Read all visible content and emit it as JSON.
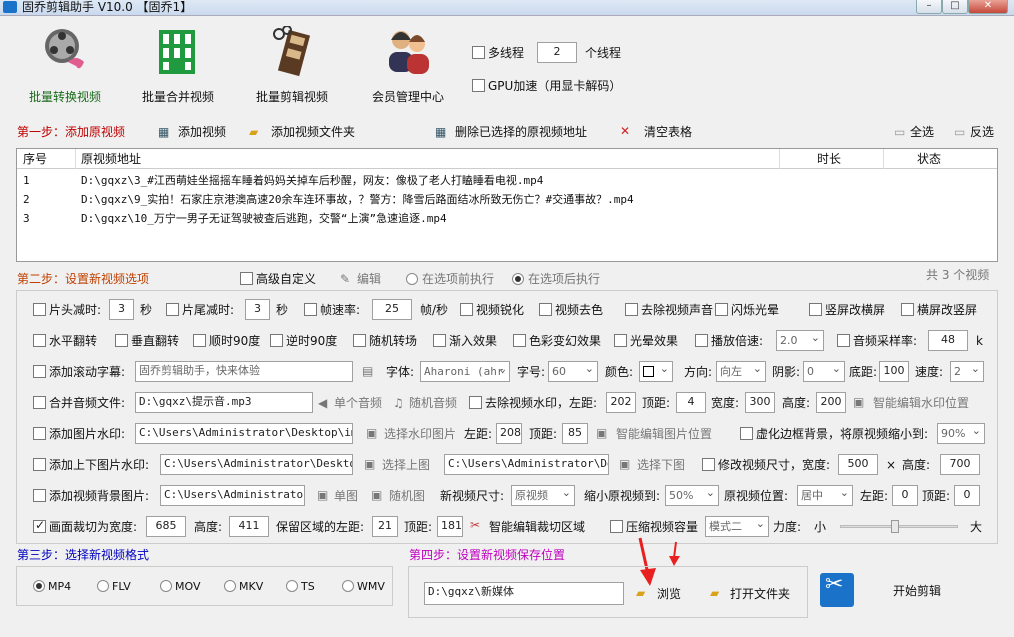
{
  "window": {
    "title": "固乔剪辑助手 V10.0 【固乔1】",
    "min": "–",
    "max": "□",
    "close": "✕"
  },
  "toolbar": {
    "batch_convert": "批量转换视频",
    "batch_merge": "批量合并视频",
    "batch_edit": "批量剪辑视频",
    "member_center": "会员管理中心",
    "multithread_label": "多线程",
    "thread_count": "2",
    "thread_unit": "个线程",
    "gpu_label": "GPU加速（用显卡解码）"
  },
  "step1": {
    "title": "第一步：添加原视频",
    "add_video": "添加视频",
    "add_folder": "添加视频文件夹",
    "delete_selected": "删除已选择的原视频地址",
    "clear_table": "清空表格",
    "select_all": "全选",
    "invert": "反选"
  },
  "table": {
    "headers": {
      "index": "序号",
      "path": "原视频地址",
      "duration": "时长",
      "status": "状态"
    },
    "rows": [
      {
        "index": "1",
        "path": "D:\\gqxz\\3_#江西萌娃坐摇摇车睡着妈妈关掉车后秒醒，网友：像极了老人打瞌睡看电视.mp4"
      },
      {
        "index": "2",
        "path": "D:\\gqxz\\9_实拍！石家庄京港澳高速20余车连环事故，？警方：降雪后路面结冰所致无伤亡？#交通事故？.mp4"
      },
      {
        "index": "3",
        "path": "D:\\gqxz\\10_万宁一男子无证驾驶被查后逃跑，交警“上演”急速追逐.mp4"
      }
    ]
  },
  "step2": {
    "title": "第二步：设置新视频选项",
    "advanced": "高级自定义",
    "edit": "编辑",
    "before": "在选项前执行",
    "after": "在选项后执行",
    "count": "共 3 个视频",
    "r1": {
      "head_cut": "片头减时:",
      "head_val": "3",
      "sec1": "秒",
      "tail_cut": "片尾减时:",
      "tail_val": "3",
      "sec2": "秒",
      "fps": "帧速率:",
      "fps_val": "25",
      "fps_unit": "帧/秒",
      "sharpen": "视频锐化",
      "decolor": "视频去色",
      "mute": "去除视频声音",
      "flash": "闪烁光晕",
      "v2h": "竖屏改横屏",
      "h2v": "横屏改竖屏"
    },
    "r2": {
      "hflip": "水平翻转",
      "vflip": "垂直翻转",
      "cw90": "顺时90度",
      "ccw90": "逆时90度",
      "random_transition": "随机转场",
      "fade_in": "渐入效果",
      "color_shift": "色彩变幻效果",
      "glow": "光晕效果",
      "speed_label": "播放倍速:",
      "speed_val": "2.0",
      "sample_label": "音频采样率:",
      "sample_val": "48",
      "sample_unit": "k"
    },
    "r3": {
      "scroll_caption": "添加滚动字幕:",
      "caption_text": "固乔剪辑助手，快来体验",
      "font_label": "字体:",
      "font_val": "Aharoni (ahr",
      "size_label": "字号:",
      "size_val": "60",
      "color_label": "颜色:",
      "dir_label": "方向:",
      "dir_val": "向左",
      "shadow_label": "阴影:",
      "shadow_val": "0",
      "bottom_label": "底距:",
      "bottom_val": "100",
      "speed_label": "速度:",
      "speed_val": "2"
    },
    "r4": {
      "merge_audio": "合并音频文件:",
      "audio_path": "D:\\gqxz\\提示音.mp3",
      "single_audio": "单个音频",
      "random_audio": "随机音频",
      "remove_watermark": "去除视频水印，左距:",
      "left_val": "202",
      "top_label": "顶距:",
      "top_val": "4",
      "width_label": "宽度:",
      "width_val": "300",
      "height_label": "高度:",
      "height_val": "200",
      "smart_watermark": "智能编辑水印位置"
    },
    "r5": {
      "img_watermark": "添加图片水印:",
      "img_path": "C:\\Users\\Administrator\\Desktop\\img-q",
      "choose_img": "选择水印图片",
      "left_label": "左距:",
      "left_val": "208",
      "top_label": "顶距:",
      "top_val": "85",
      "smart_img": "智能编辑图片位置",
      "blur_border": "虚化边框背景，将原视频缩小到:",
      "shrink_val": "90%"
    },
    "r6": {
      "top_bottom_img": "添加上下图片水印:",
      "top_path": "C:\\Users\\Administrator\\Desktop\\i",
      "choose_top": "选择上图",
      "bottom_path": "C:\\Users\\Administrator\\Desk",
      "choose_bottom": "选择下图",
      "resize": "修改视频尺寸，宽度:",
      "w_val": "500",
      "x": "×",
      "h_label": "高度:",
      "h_val": "700"
    },
    "r7": {
      "bg_img": "添加视频背景图片:",
      "bg_path": "C:\\Users\\Administrator\\D",
      "single_img": "单图",
      "random_img": "随机图",
      "new_size_label": "新视频尺寸:",
      "new_size_val": "原视频",
      "shrink_label": "缩小原视频到:",
      "shrink_val": "50%",
      "pos_label": "原视频位置:",
      "pos_val": "居中",
      "left_label": "左距:",
      "left_val": "0",
      "top_label": "顶距:",
      "top_val": "0"
    },
    "r8": {
      "crop": "画面裁切为宽度:",
      "crop_w": "685",
      "h_label": "高度:",
      "crop_h": "411",
      "keep_left": "保留区域的左距:",
      "left_val": "21",
      "top_label": "顶距:",
      "top_val": "181",
      "smart_crop": "智能编辑裁切区域",
      "compress": "压缩视频容量",
      "mode_val": "模式二",
      "strength": "力度:",
      "small": "小",
      "big": "大",
      "strength_level": 0.45
    }
  },
  "step3": {
    "title": "第三步：选择新视频格式",
    "formats": [
      "MP4",
      "FLV",
      "MOV",
      "MKV",
      "TS",
      "WMV"
    ],
    "selected": "MP4"
  },
  "step4": {
    "title": "第四步：设置新视频保存位置",
    "path": "D:\\gqxz\\新媒体",
    "browse": "浏览",
    "open_folder": "打开文件夹",
    "start": "开始剪辑"
  },
  "colors": {
    "step1": "#c00000",
    "step3": "#0000c0",
    "step4": "#c000c0",
    "accent": "#1a73c9",
    "arrow": "#e82020"
  }
}
